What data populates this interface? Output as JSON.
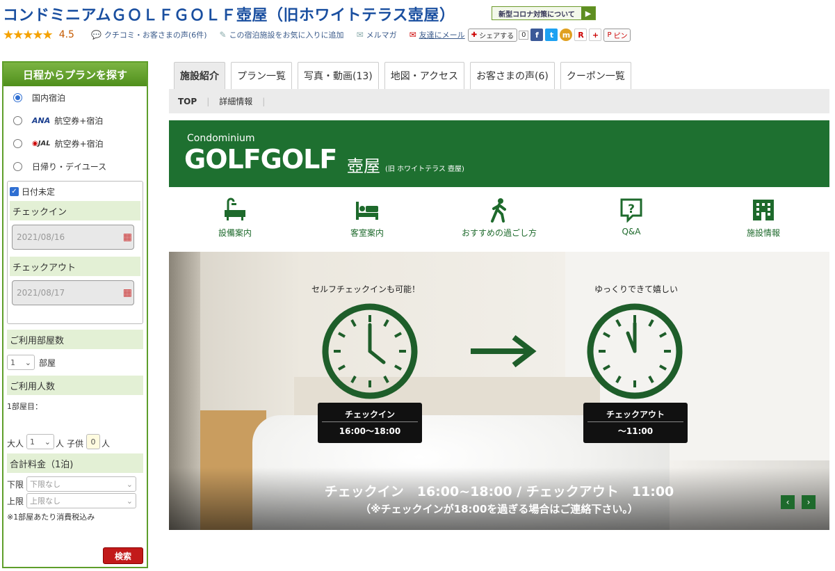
{
  "header": {
    "title": "コンドミニアムＧＯＬＦＧＯＬＦ壺屋（旧ホワイトテラス壺屋）",
    "covid_label": "新型コロナ対策について",
    "rating": "4.5",
    "reviews_link": "クチコミ・お客さまの声(6件)",
    "favorite_link": "この宿泊施設をお気に入りに追加",
    "magazine_link": "メルマガ",
    "mail_link": "友達にメール",
    "share_label": "シェアする",
    "share_count": "0",
    "pin_label": "ピン"
  },
  "sidebar": {
    "title": "日程からプランを探す",
    "radios": [
      {
        "label": "国内宿泊",
        "selected": true
      },
      {
        "label": "航空券+宿泊",
        "brand": "ANA"
      },
      {
        "label": "航空券+宿泊",
        "brand": "JAL"
      },
      {
        "label": "日帰り・デイユース"
      }
    ],
    "date_undecided": "日付未定",
    "checkin_label": "チェックイン",
    "checkin_value": "2021/08/16",
    "checkout_label": "チェックアウト",
    "checkout_value": "2021/08/17",
    "rooms_label": "ご利用部屋数",
    "rooms_value": "1",
    "rooms_unit": "部屋",
    "people_label": "ご利用人数",
    "room1_label": "1部屋目：",
    "adult_label": "大人",
    "adult_value": "1",
    "person_unit": "人",
    "child_label": "子供",
    "child_value": "0",
    "price_label": "合計料金（1泊)",
    "lower_label": "下限",
    "lower_value": "下限なし",
    "upper_label": "上限",
    "upper_value": "上限なし",
    "note": "※1部屋あたり消費税込み",
    "search_button": "検索"
  },
  "tabs": [
    {
      "label": "施設紹介",
      "active": true
    },
    {
      "label": "プラン一覧"
    },
    {
      "label": "写真・動画(13)"
    },
    {
      "label": "地図・アクセス"
    },
    {
      "label": "お客さまの声(6)"
    },
    {
      "label": "クーポン一覧"
    }
  ],
  "subnav": {
    "top": "TOP",
    "detail": "詳細情報"
  },
  "banner": {
    "condominium": "Condominium",
    "logo": "GOLFGOLF",
    "name": "壺屋",
    "old_name": "(旧 ホワイトテラス 壺屋)"
  },
  "icon_nav": [
    {
      "label": "設備案内",
      "icon": "bathtub-icon"
    },
    {
      "label": "客室案内",
      "icon": "bed-icon"
    },
    {
      "label": "おすすめの過ごし方",
      "icon": "walking-person-icon"
    },
    {
      "label": "Q&A",
      "icon": "question-bubble-icon"
    },
    {
      "label": "施設情報",
      "icon": "building-icon"
    }
  ],
  "hero": {
    "left_caption": "セルフチェックインも可能！",
    "right_caption": "ゆっくりできて嬉しい",
    "checkin_title": "チェックイン",
    "checkin_time": "16:00〜18:00",
    "checkout_title": "チェックアウト",
    "checkout_time": "〜11:00",
    "line1": "チェックイン　16:00~18:00 / チェックアウト　11:00",
    "line2": "（※チェックインが18:00を過ぎる場合はご連絡下さい。）"
  },
  "colors": {
    "brand_green": "#1e7030",
    "title_blue": "#1a4fa0",
    "search_red": "#c21a1a"
  }
}
